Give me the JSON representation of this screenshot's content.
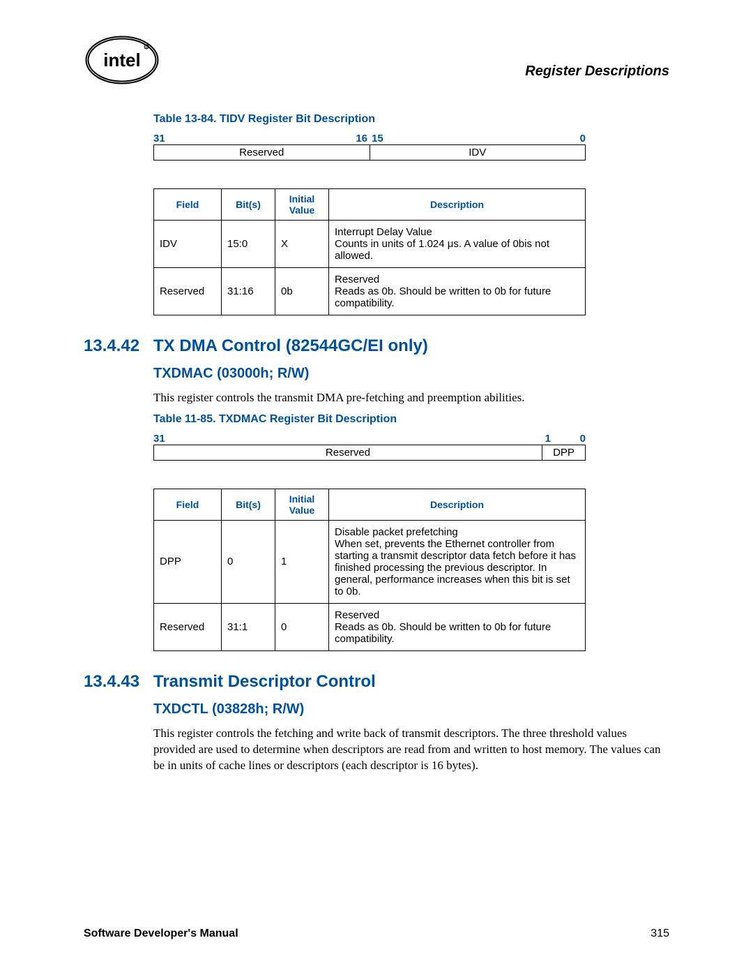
{
  "header": {
    "title": "Register Descriptions"
  },
  "table84": {
    "caption": "Table 13-84. TIDV Register Bit Description",
    "bits": {
      "b31": "31",
      "b16": "16",
      "b15": "15",
      "b0": "0"
    },
    "cells": {
      "reserved": "Reserved",
      "idv": "IDV"
    },
    "headers": {
      "field": "Field",
      "bits": "Bit(s)",
      "initial": "Initial Value",
      "desc": "Description"
    },
    "rows": [
      {
        "field": "IDV",
        "bits": "15:0",
        "initial": "X",
        "desc": "Interrupt Delay Value\nCounts in units of 1.024 μs. A value of 0bis not allowed."
      },
      {
        "field": "Reserved",
        "bits": "31:16",
        "initial": "0b",
        "desc": "Reserved\nReads as 0b. Should be written to 0b for future compatibility."
      }
    ]
  },
  "section42": {
    "num": "13.4.42",
    "title": "TX DMA Control (82544GC/EI only)",
    "sub": "TXDMAC (03000h; R/W)",
    "body": "This register controls the transmit DMA pre-fetching and preemption abilities."
  },
  "table85": {
    "caption": "Table 11-85. TXDMAC Register Bit Description",
    "bits": {
      "b31": "31",
      "b1": "1",
      "b0": "0"
    },
    "cells": {
      "reserved": "Reserved",
      "dpp": "DPP"
    },
    "headers": {
      "field": "Field",
      "bits": "Bit(s)",
      "initial": "Initial Value",
      "desc": "Description"
    },
    "rows": [
      {
        "field": "DPP",
        "bits": "0",
        "initial": "1",
        "desc": "Disable packet prefetching\nWhen set, prevents the Ethernet controller from starting a transmit descriptor data fetch before it has finished processing the previous descriptor. In general, performance increases when this bit is set to 0b."
      },
      {
        "field": "Reserved",
        "bits": "31:1",
        "initial": "0",
        "desc": "Reserved\nReads as 0b. Should be written to 0b for future compatibility."
      }
    ]
  },
  "section43": {
    "num": "13.4.43",
    "title": "Transmit Descriptor Control",
    "sub": "TXDCTL (03828h; R/W)",
    "body": "This register controls the fetching and write back of transmit descriptors. The three threshold values provided are used to determine when descriptors are read from and written to host memory. The values can be in units of cache lines or descriptors (each descriptor is 16 bytes)."
  },
  "footer": {
    "left": "Software Developer's Manual",
    "right": "315"
  }
}
